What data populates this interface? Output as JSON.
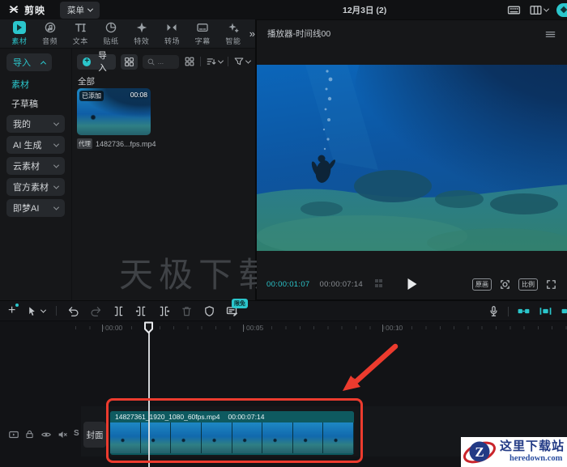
{
  "titlebar": {
    "app_name": "剪映",
    "menu_label": "菜单",
    "date_label": "12月3日 (2)"
  },
  "ribbon": {
    "tabs": [
      {
        "label": "素材",
        "active": true
      },
      {
        "label": "音频",
        "active": false
      },
      {
        "label": "文本",
        "active": false
      },
      {
        "label": "贴纸",
        "active": false
      },
      {
        "label": "特效",
        "active": false
      },
      {
        "label": "转场",
        "active": false
      },
      {
        "label": "字幕",
        "active": false
      },
      {
        "label": "智能",
        "active": false
      }
    ],
    "expand_label": "»"
  },
  "sidebar": {
    "items": [
      {
        "label": "导入",
        "state": "expanded"
      },
      {
        "label": "素材",
        "state": "selected"
      },
      {
        "label": "子草稿",
        "state": "normal"
      },
      {
        "label": "我的",
        "state": "collapsed"
      },
      {
        "label": "AI 生成",
        "state": "collapsed"
      },
      {
        "label": "云素材",
        "state": "collapsed"
      },
      {
        "label": "官方素材",
        "state": "collapsed"
      },
      {
        "label": "即梦AI",
        "state": "collapsed"
      }
    ]
  },
  "media": {
    "import_label": "导入",
    "search_placeholder": "...",
    "filter_all_label": "全部",
    "card": {
      "added_badge": "已添加",
      "duration": "00:08",
      "proxy_badge": "代理",
      "filename": "1482736...fps.mp4"
    },
    "watermark_text": "天极下载"
  },
  "player": {
    "title": "播放器-时间线00",
    "current_time": "00:00:01:07",
    "total_duration": "00:00:07:14",
    "original_quality_label": "原画",
    "ratio_label": "比例"
  },
  "timeline": {
    "limited_free_badge": "限免",
    "ruler_labels": [
      "00:00",
      "00:05",
      "00:10"
    ],
    "cover_label": "封面",
    "solo_label": "S",
    "clip": {
      "filename": "14827361_1920_1080_60fps.mp4",
      "duration": "00:00:07:14"
    }
  },
  "footer_logo": {
    "letter": "Z",
    "site_name": "这里下载站",
    "site_url": "heredown.com"
  },
  "colors": {
    "accent": "#2bc6cc",
    "annotation_red": "#ec3b2e"
  }
}
